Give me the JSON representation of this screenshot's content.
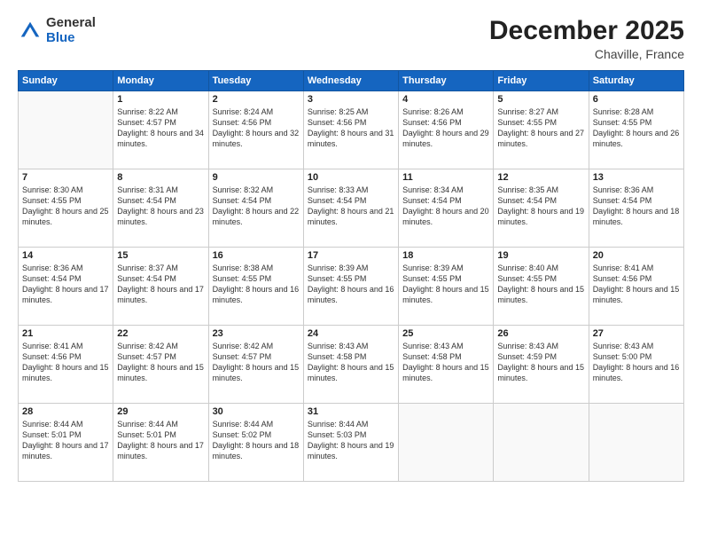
{
  "logo": {
    "general": "General",
    "blue": "Blue"
  },
  "title": "December 2025",
  "location": "Chaville, France",
  "weekdays": [
    "Sunday",
    "Monday",
    "Tuesday",
    "Wednesday",
    "Thursday",
    "Friday",
    "Saturday"
  ],
  "weeks": [
    [
      {
        "day": "",
        "empty": true
      },
      {
        "day": "1",
        "sunrise": "8:22 AM",
        "sunset": "4:57 PM",
        "daylight": "8 hours and 34 minutes."
      },
      {
        "day": "2",
        "sunrise": "8:24 AM",
        "sunset": "4:56 PM",
        "daylight": "8 hours and 32 minutes."
      },
      {
        "day": "3",
        "sunrise": "8:25 AM",
        "sunset": "4:56 PM",
        "daylight": "8 hours and 31 minutes."
      },
      {
        "day": "4",
        "sunrise": "8:26 AM",
        "sunset": "4:56 PM",
        "daylight": "8 hours and 29 minutes."
      },
      {
        "day": "5",
        "sunrise": "8:27 AM",
        "sunset": "4:55 PM",
        "daylight": "8 hours and 27 minutes."
      },
      {
        "day": "6",
        "sunrise": "8:28 AM",
        "sunset": "4:55 PM",
        "daylight": "8 hours and 26 minutes."
      }
    ],
    [
      {
        "day": "7",
        "sunrise": "8:30 AM",
        "sunset": "4:55 PM",
        "daylight": "8 hours and 25 minutes."
      },
      {
        "day": "8",
        "sunrise": "8:31 AM",
        "sunset": "4:54 PM",
        "daylight": "8 hours and 23 minutes."
      },
      {
        "day": "9",
        "sunrise": "8:32 AM",
        "sunset": "4:54 PM",
        "daylight": "8 hours and 22 minutes."
      },
      {
        "day": "10",
        "sunrise": "8:33 AM",
        "sunset": "4:54 PM",
        "daylight": "8 hours and 21 minutes."
      },
      {
        "day": "11",
        "sunrise": "8:34 AM",
        "sunset": "4:54 PM",
        "daylight": "8 hours and 20 minutes."
      },
      {
        "day": "12",
        "sunrise": "8:35 AM",
        "sunset": "4:54 PM",
        "daylight": "8 hours and 19 minutes."
      },
      {
        "day": "13",
        "sunrise": "8:36 AM",
        "sunset": "4:54 PM",
        "daylight": "8 hours and 18 minutes."
      }
    ],
    [
      {
        "day": "14",
        "sunrise": "8:36 AM",
        "sunset": "4:54 PM",
        "daylight": "8 hours and 17 minutes."
      },
      {
        "day": "15",
        "sunrise": "8:37 AM",
        "sunset": "4:54 PM",
        "daylight": "8 hours and 17 minutes."
      },
      {
        "day": "16",
        "sunrise": "8:38 AM",
        "sunset": "4:55 PM",
        "daylight": "8 hours and 16 minutes."
      },
      {
        "day": "17",
        "sunrise": "8:39 AM",
        "sunset": "4:55 PM",
        "daylight": "8 hours and 16 minutes."
      },
      {
        "day": "18",
        "sunrise": "8:39 AM",
        "sunset": "4:55 PM",
        "daylight": "8 hours and 15 minutes."
      },
      {
        "day": "19",
        "sunrise": "8:40 AM",
        "sunset": "4:55 PM",
        "daylight": "8 hours and 15 minutes."
      },
      {
        "day": "20",
        "sunrise": "8:41 AM",
        "sunset": "4:56 PM",
        "daylight": "8 hours and 15 minutes."
      }
    ],
    [
      {
        "day": "21",
        "sunrise": "8:41 AM",
        "sunset": "4:56 PM",
        "daylight": "8 hours and 15 minutes."
      },
      {
        "day": "22",
        "sunrise": "8:42 AM",
        "sunset": "4:57 PM",
        "daylight": "8 hours and 15 minutes."
      },
      {
        "day": "23",
        "sunrise": "8:42 AM",
        "sunset": "4:57 PM",
        "daylight": "8 hours and 15 minutes."
      },
      {
        "day": "24",
        "sunrise": "8:43 AM",
        "sunset": "4:58 PM",
        "daylight": "8 hours and 15 minutes."
      },
      {
        "day": "25",
        "sunrise": "8:43 AM",
        "sunset": "4:58 PM",
        "daylight": "8 hours and 15 minutes."
      },
      {
        "day": "26",
        "sunrise": "8:43 AM",
        "sunset": "4:59 PM",
        "daylight": "8 hours and 15 minutes."
      },
      {
        "day": "27",
        "sunrise": "8:43 AM",
        "sunset": "5:00 PM",
        "daylight": "8 hours and 16 minutes."
      }
    ],
    [
      {
        "day": "28",
        "sunrise": "8:44 AM",
        "sunset": "5:01 PM",
        "daylight": "8 hours and 17 minutes."
      },
      {
        "day": "29",
        "sunrise": "8:44 AM",
        "sunset": "5:01 PM",
        "daylight": "8 hours and 17 minutes."
      },
      {
        "day": "30",
        "sunrise": "8:44 AM",
        "sunset": "5:02 PM",
        "daylight": "8 hours and 18 minutes."
      },
      {
        "day": "31",
        "sunrise": "8:44 AM",
        "sunset": "5:03 PM",
        "daylight": "8 hours and 19 minutes."
      },
      {
        "day": "",
        "empty": true
      },
      {
        "day": "",
        "empty": true
      },
      {
        "day": "",
        "empty": true
      }
    ]
  ],
  "labels": {
    "sunrise": "Sunrise:",
    "sunset": "Sunset:",
    "daylight": "Daylight:"
  }
}
